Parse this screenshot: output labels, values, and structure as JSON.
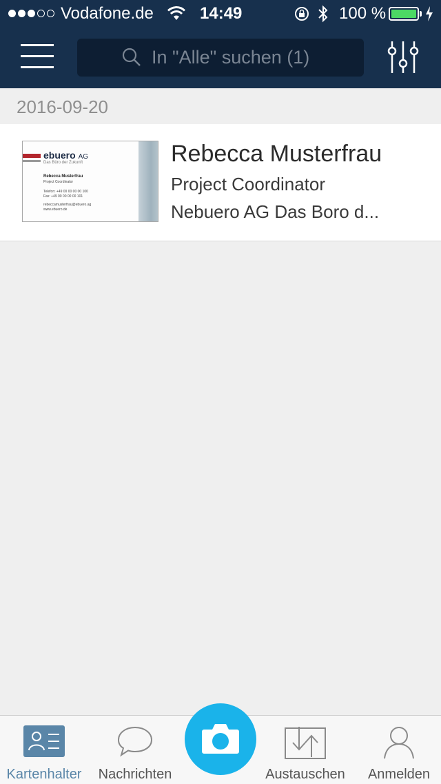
{
  "status_bar": {
    "carrier": "Vodafone.de",
    "time": "14:49",
    "battery_percent": "100 %",
    "battery_level": 1.0,
    "signal_bars_filled": 3,
    "signal_bars_total": 5
  },
  "header": {
    "search_placeholder": "In \"Alle\" suchen (1)",
    "menu_icon": "hamburger-menu-icon",
    "filter_icon": "sliders-icon",
    "search_icon": "search-icon"
  },
  "list": {
    "date_group": "2016-09-20",
    "cards": [
      {
        "name": "Rebecca Musterfrau",
        "title": "Project Coordinator",
        "company": "Nebuero AG Das Boro d...",
        "thumbnail": {
          "logo": "ebuero",
          "logo_suffix": "AG",
          "tagline": "Das Büro der Zukunft",
          "name": "Rebecca Musterfrau",
          "role": "Project Coordinator",
          "phone": "Telefon:    +49 00 00 00 00 100",
          "fax": "Fax:          +49 00 00 00 00 101",
          "email": "rebeccamusterfrau@ebuero.ag",
          "web": "www.ebuero.de"
        }
      }
    ]
  },
  "tabbar": {
    "tabs": [
      {
        "label": "Kartenhalter",
        "icon": "contacts-icon",
        "active": true
      },
      {
        "label": "Nachrichten",
        "icon": "chat-bubble-icon",
        "active": false
      },
      {
        "label": "Austauschen",
        "icon": "exchange-icon",
        "active": false
      },
      {
        "label": "Anmelden",
        "icon": "person-icon",
        "active": false
      }
    ],
    "camera_icon": "camera-icon"
  },
  "colors": {
    "header_bg": "#17304d",
    "search_bg": "#0d1e33",
    "accent": "#1ab3ea",
    "active_tab": "#5a86a8",
    "battery_green": "#4cd964"
  }
}
